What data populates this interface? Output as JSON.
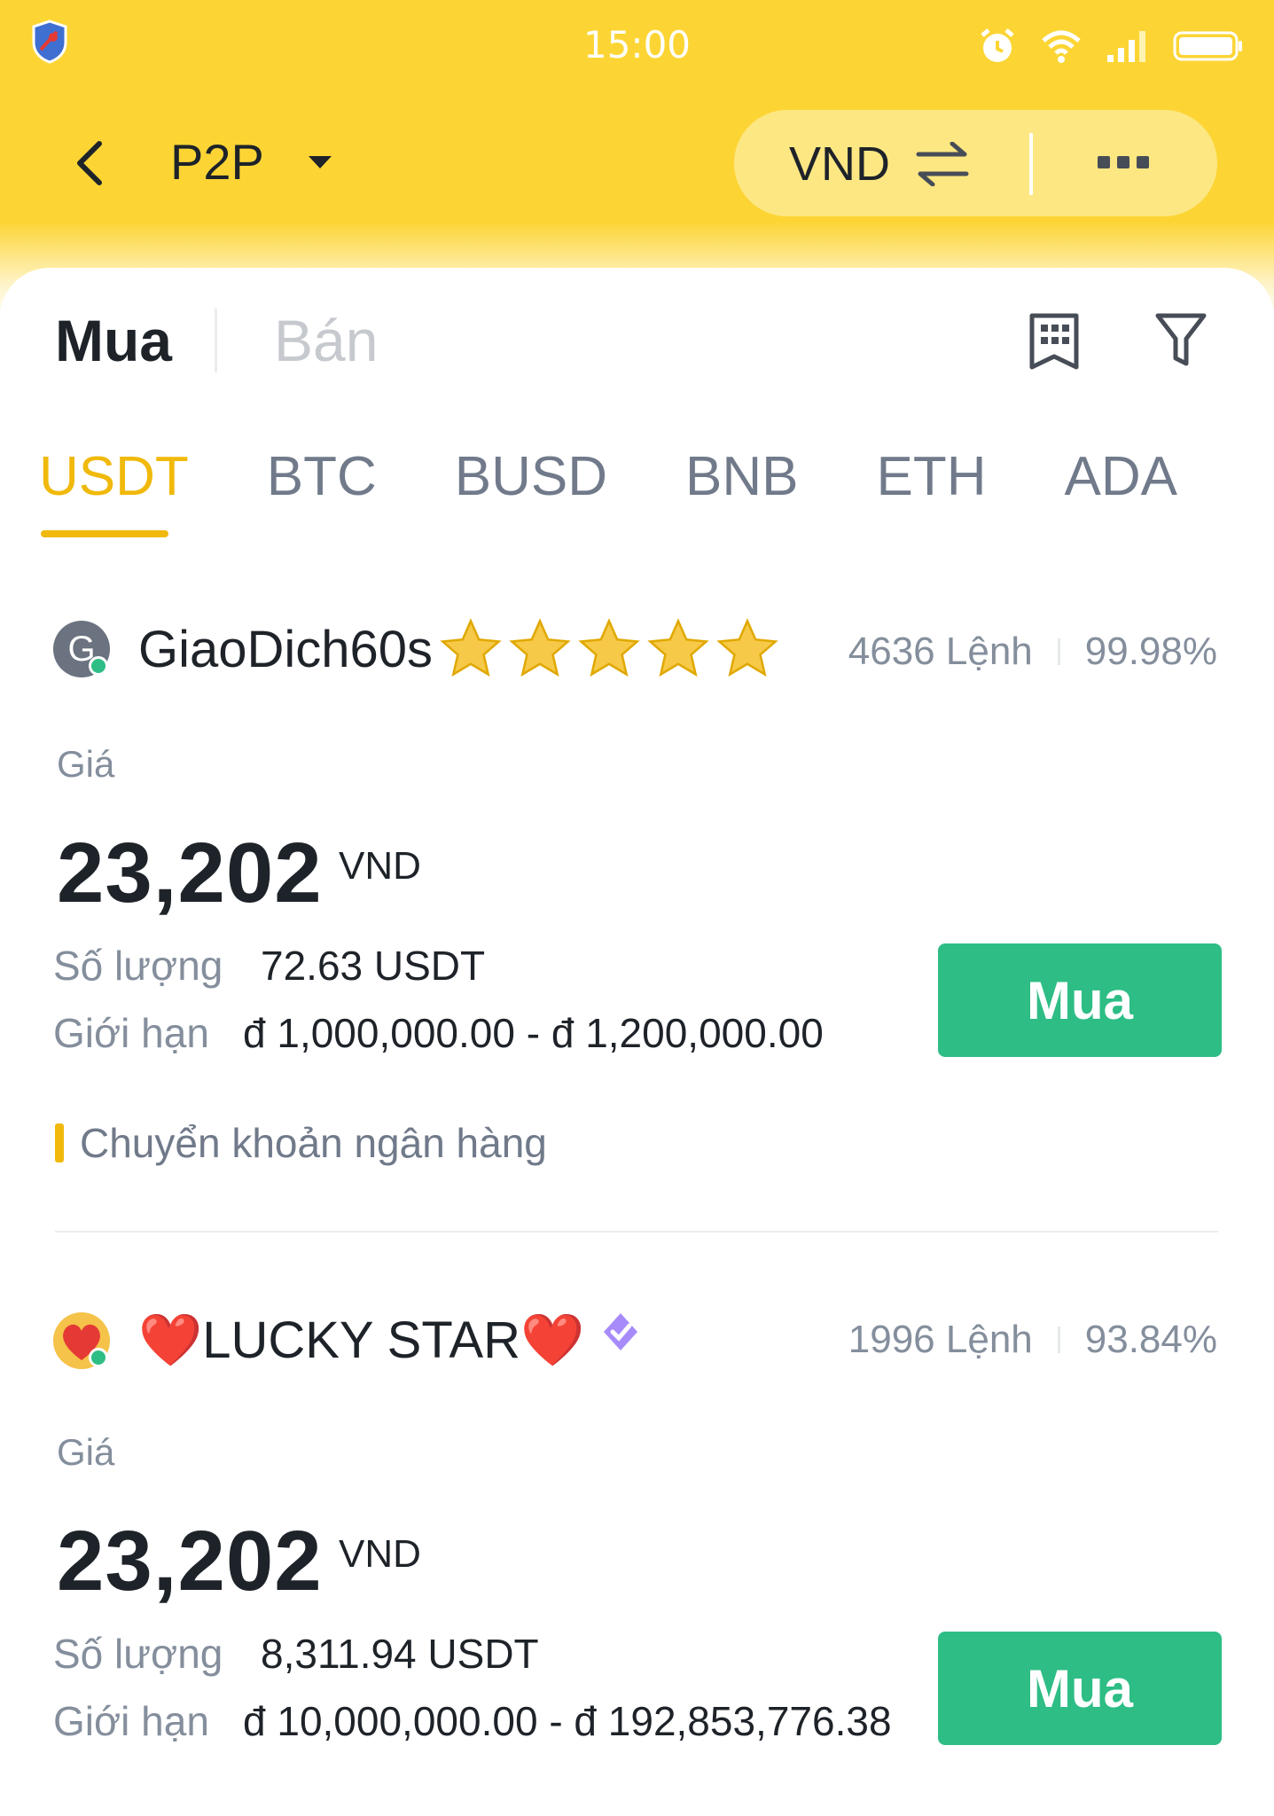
{
  "status": {
    "time": "15:00"
  },
  "nav": {
    "title": "P2P",
    "currency": "VND"
  },
  "tabs": {
    "buy": "Mua",
    "sell": "Bán"
  },
  "coins": [
    "USDT",
    "BTC",
    "BUSD",
    "BNB",
    "ETH",
    "ADA"
  ],
  "active_coin": "USDT",
  "labels": {
    "price": "Giá",
    "quantity": "Số lượng",
    "limit": "Giới hạn",
    "buy_button": "Mua"
  },
  "offers": [
    {
      "merchant": "GiaoDich60s",
      "avatar_letter": "G",
      "rating_stars": 5,
      "orders": "4636 Lệnh",
      "completion": "99.98%",
      "price": "23,202",
      "price_currency": "VND",
      "quantity": "72.63 USDT",
      "limit": "đ 1,000,000.00 - đ 1,200,000.00",
      "payment": "Chuyển khoản ngân hàng"
    },
    {
      "merchant": "❤️LUCKY STAR❤️",
      "orders": "1996 Lệnh",
      "completion": "93.84%",
      "price": "23,202",
      "price_currency": "VND",
      "quantity": "8,311.94 USDT",
      "limit": "đ 10,000,000.00 - đ 192,853,776.38"
    }
  ],
  "colors": {
    "brand_yellow": "#fcd535",
    "accent": "#f0b90b",
    "buy_green": "#2ebd85"
  }
}
